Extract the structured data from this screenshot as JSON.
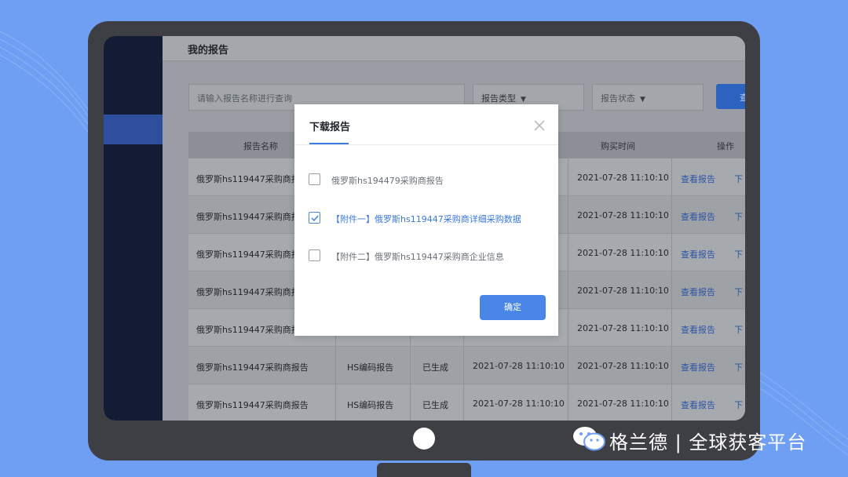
{
  "sidebar": {
    "items": [
      {
        "label": "",
        "active": false
      },
      {
        "label": "",
        "active": true
      }
    ]
  },
  "main": {
    "page_title": "我的报告",
    "search": {
      "placeholder": "请输入报告名称进行查询"
    },
    "filters": {
      "type_label": "报告类型",
      "status_label": "报告状态"
    },
    "query_button": "查",
    "table": {
      "columns": [
        "报告名称",
        "",
        "",
        "",
        "购买时间",
        "操作"
      ],
      "rows": [
        {
          "name": "俄罗斯hs119447采购商报",
          "type": "",
          "status": "",
          "gen_time": "",
          "buy_time": "2021-07-28  11:10:10",
          "view": "查看报告",
          "download": "下"
        },
        {
          "name": "俄罗斯hs119447采购商报",
          "type": "",
          "status": "",
          "gen_time": "",
          "buy_time": "2021-07-28  11:10:10",
          "view": "查看报告",
          "download": "下"
        },
        {
          "name": "俄罗斯hs119447采购商报",
          "type": "",
          "status": "",
          "gen_time": "",
          "buy_time": "2021-07-28  11:10:10",
          "view": "查看报告",
          "download": "下"
        },
        {
          "name": "俄罗斯hs119447采购商报",
          "type": "",
          "status": "",
          "gen_time": "",
          "buy_time": "2021-07-28  11:10:10",
          "view": "查看报告",
          "download": "下"
        },
        {
          "name": "俄罗斯hs119447采购商报",
          "type": "",
          "status": "",
          "gen_time": "",
          "buy_time": "2021-07-28  11:10:10",
          "view": "查看报告",
          "download": "下"
        },
        {
          "name": "俄罗斯hs119447采购商报告",
          "type": "HS编码报告",
          "status": "已生成",
          "gen_time": "2021-07-28  11:10:10",
          "buy_time": "2021-07-28  11:10:10",
          "view": "查看报告",
          "download": "下"
        },
        {
          "name": "俄罗斯hs119447采购商报告",
          "type": "HS编码报告",
          "status": "已生成",
          "gen_time": "2021-07-28  11:10:10",
          "buy_time": "2021-07-28  11:10:10",
          "view": "查看报告",
          "download": "下"
        }
      ]
    }
  },
  "modal": {
    "title": "下载报告",
    "options": [
      {
        "label": "俄罗斯hs194479采购商报告",
        "checked": false
      },
      {
        "label": "【附件一】俄罗斯hs119447采购商详细采购数据",
        "checked": true
      },
      {
        "label": "【附件二】俄罗斯hs119447采购商企业信息",
        "checked": false
      }
    ],
    "confirm_label": "确定"
  },
  "brand": {
    "text": "格兰德 | 全球获客平台"
  },
  "colors": {
    "accent": "#4a86e8",
    "background": "#6f9ff3",
    "monitor": "#3d3f44"
  }
}
